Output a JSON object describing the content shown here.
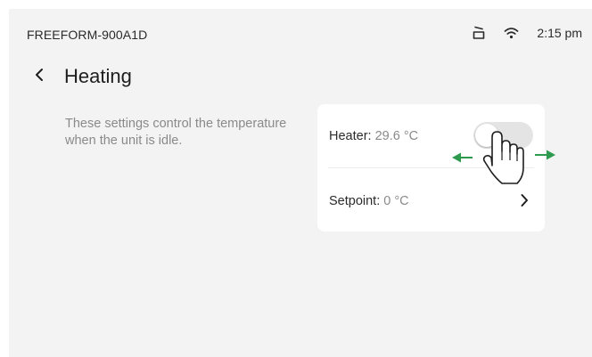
{
  "status": {
    "device_name": "FREEFORM-900A1D",
    "time": "2:15 pm",
    "icons": [
      "pan-icon",
      "wifi-icon"
    ]
  },
  "header": {
    "title": "Heating",
    "back_icon": "chevron-left-icon"
  },
  "description": "These settings control the temperature when the unit is idle.",
  "settings": {
    "heater": {
      "label": "Heater:",
      "value": "29.6 °C",
      "toggle_on": false
    },
    "setpoint": {
      "label": "Setpoint:",
      "value": "0 °C",
      "icon": "chevron-right-icon"
    }
  },
  "gesture_hint": {
    "icons": [
      "hand-pointer-icon",
      "arrow-left-icon",
      "arrow-right-icon"
    ],
    "arrow_color": "#2e9a4e"
  },
  "colors": {
    "background": "#f3f3f3",
    "card": "#ffffff",
    "toggle_off": "#e4e4e4",
    "muted_text": "#8a8a8a",
    "primary_text": "#1e1e1e"
  }
}
